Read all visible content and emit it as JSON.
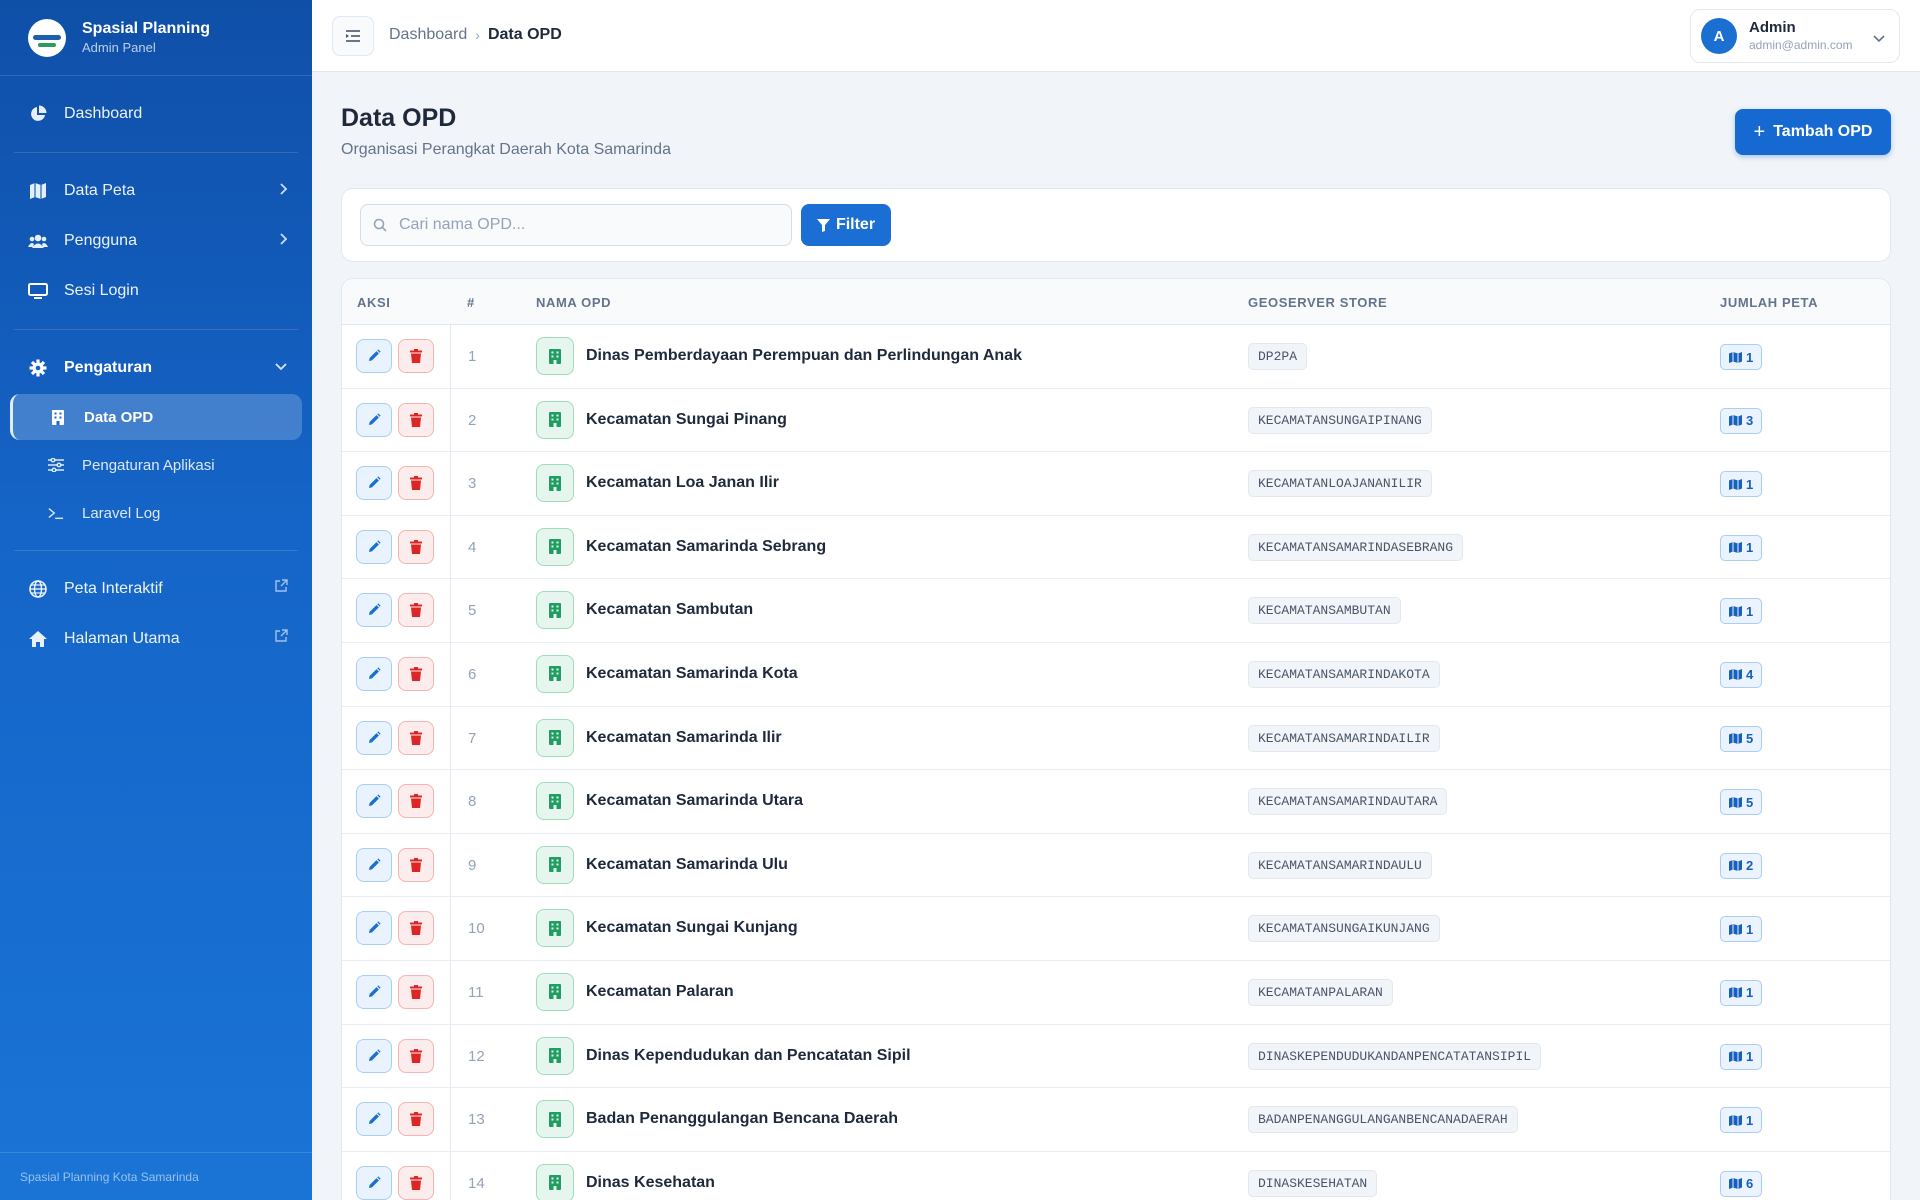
{
  "brand": {
    "title": "Spasial Planning",
    "subtitle": "Admin Panel"
  },
  "sidebar": {
    "items": [
      {
        "label": "Dashboard",
        "icon": "chart-pie-icon"
      },
      {
        "label": "Data Peta",
        "icon": "map-icon"
      },
      {
        "label": "Pengguna",
        "icon": "users-icon"
      },
      {
        "label": "Sesi Login",
        "icon": "desktop-icon"
      },
      {
        "label": "Pengaturan",
        "icon": "gear-icon"
      }
    ],
    "sub_items": [
      {
        "label": "Data OPD",
        "icon": "building-icon",
        "active": true
      },
      {
        "label": "Pengaturan Aplikasi",
        "icon": "sliders-icon"
      },
      {
        "label": "Laravel Log",
        "icon": "terminal-icon"
      }
    ],
    "links": [
      {
        "label": "Peta Interaktif",
        "icon": "globe-icon"
      },
      {
        "label": "Halaman Utama",
        "icon": "home-icon"
      }
    ],
    "footer": "Spasial Planning Kota Samarinda"
  },
  "breadcrumb": {
    "parent": "Dashboard",
    "current": "Data OPD"
  },
  "user": {
    "initial": "A",
    "name": "Admin",
    "email": "admin@admin.com"
  },
  "page": {
    "title": "Data OPD",
    "subtitle": "Organisasi Perangkat Daerah Kota Samarinda",
    "add_label": "Tambah OPD"
  },
  "search": {
    "placeholder": "Cari nama OPD...",
    "value": "",
    "filter_label": "Filter"
  },
  "table": {
    "headers": {
      "aksi": "AKSI",
      "num": "#",
      "nama": "NAMA OPD",
      "store": "GEOSERVER STORE",
      "peta": "JUMLAH PETA"
    },
    "rows": [
      {
        "no": "1",
        "nama": "Dinas Pemberdayaan Perempuan dan Perlindungan Anak",
        "store": "DP2PA",
        "peta": "1"
      },
      {
        "no": "2",
        "nama": "Kecamatan Sungai Pinang",
        "store": "KECAMATANSUNGAIPINANG",
        "peta": "3"
      },
      {
        "no": "3",
        "nama": "Kecamatan Loa Janan Ilir",
        "store": "KECAMATANLOAJANANILIR",
        "peta": "1"
      },
      {
        "no": "4",
        "nama": "Kecamatan Samarinda Sebrang",
        "store": "KECAMATANSAMARINDASEBRANG",
        "peta": "1"
      },
      {
        "no": "5",
        "nama": "Kecamatan Sambutan",
        "store": "KECAMATANSAMBUTAN",
        "peta": "1"
      },
      {
        "no": "6",
        "nama": "Kecamatan Samarinda Kota",
        "store": "KECAMATANSAMARINDAKOTA",
        "peta": "4"
      },
      {
        "no": "7",
        "nama": "Kecamatan Samarinda Ilir",
        "store": "KECAMATANSAMARINDAILIR",
        "peta": "5"
      },
      {
        "no": "8",
        "nama": "Kecamatan Samarinda Utara",
        "store": "KECAMATANSAMARINDAUTARA",
        "peta": "5"
      },
      {
        "no": "9",
        "nama": "Kecamatan Samarinda Ulu",
        "store": "KECAMATANSAMARINDAULU",
        "peta": "2"
      },
      {
        "no": "10",
        "nama": "Kecamatan Sungai Kunjang",
        "store": "KECAMATANSUNGAIKUNJANG",
        "peta": "1"
      },
      {
        "no": "11",
        "nama": "Kecamatan Palaran",
        "store": "KECAMATANPALARAN",
        "peta": "1"
      },
      {
        "no": "12",
        "nama": "Dinas Kependudukan dan Pencatatan Sipil",
        "store": "DINASKEPENDUDUKANDANPENCATATANSIPIL",
        "peta": "1"
      },
      {
        "no": "13",
        "nama": "Badan Penanggulangan Bencana Daerah",
        "store": "BADANPENANGGULANGANBENCANADAERAH",
        "peta": "1"
      },
      {
        "no": "14",
        "nama": "Dinas Kesehatan",
        "store": "DINASKESEHATAN",
        "peta": "6"
      }
    ]
  },
  "colors": {
    "sidebar_top": "#0f4fa8",
    "sidebar_bottom": "#1a74d6",
    "primary": "#1669d1",
    "danger": "#dc2626",
    "success": "#1f9d62"
  }
}
